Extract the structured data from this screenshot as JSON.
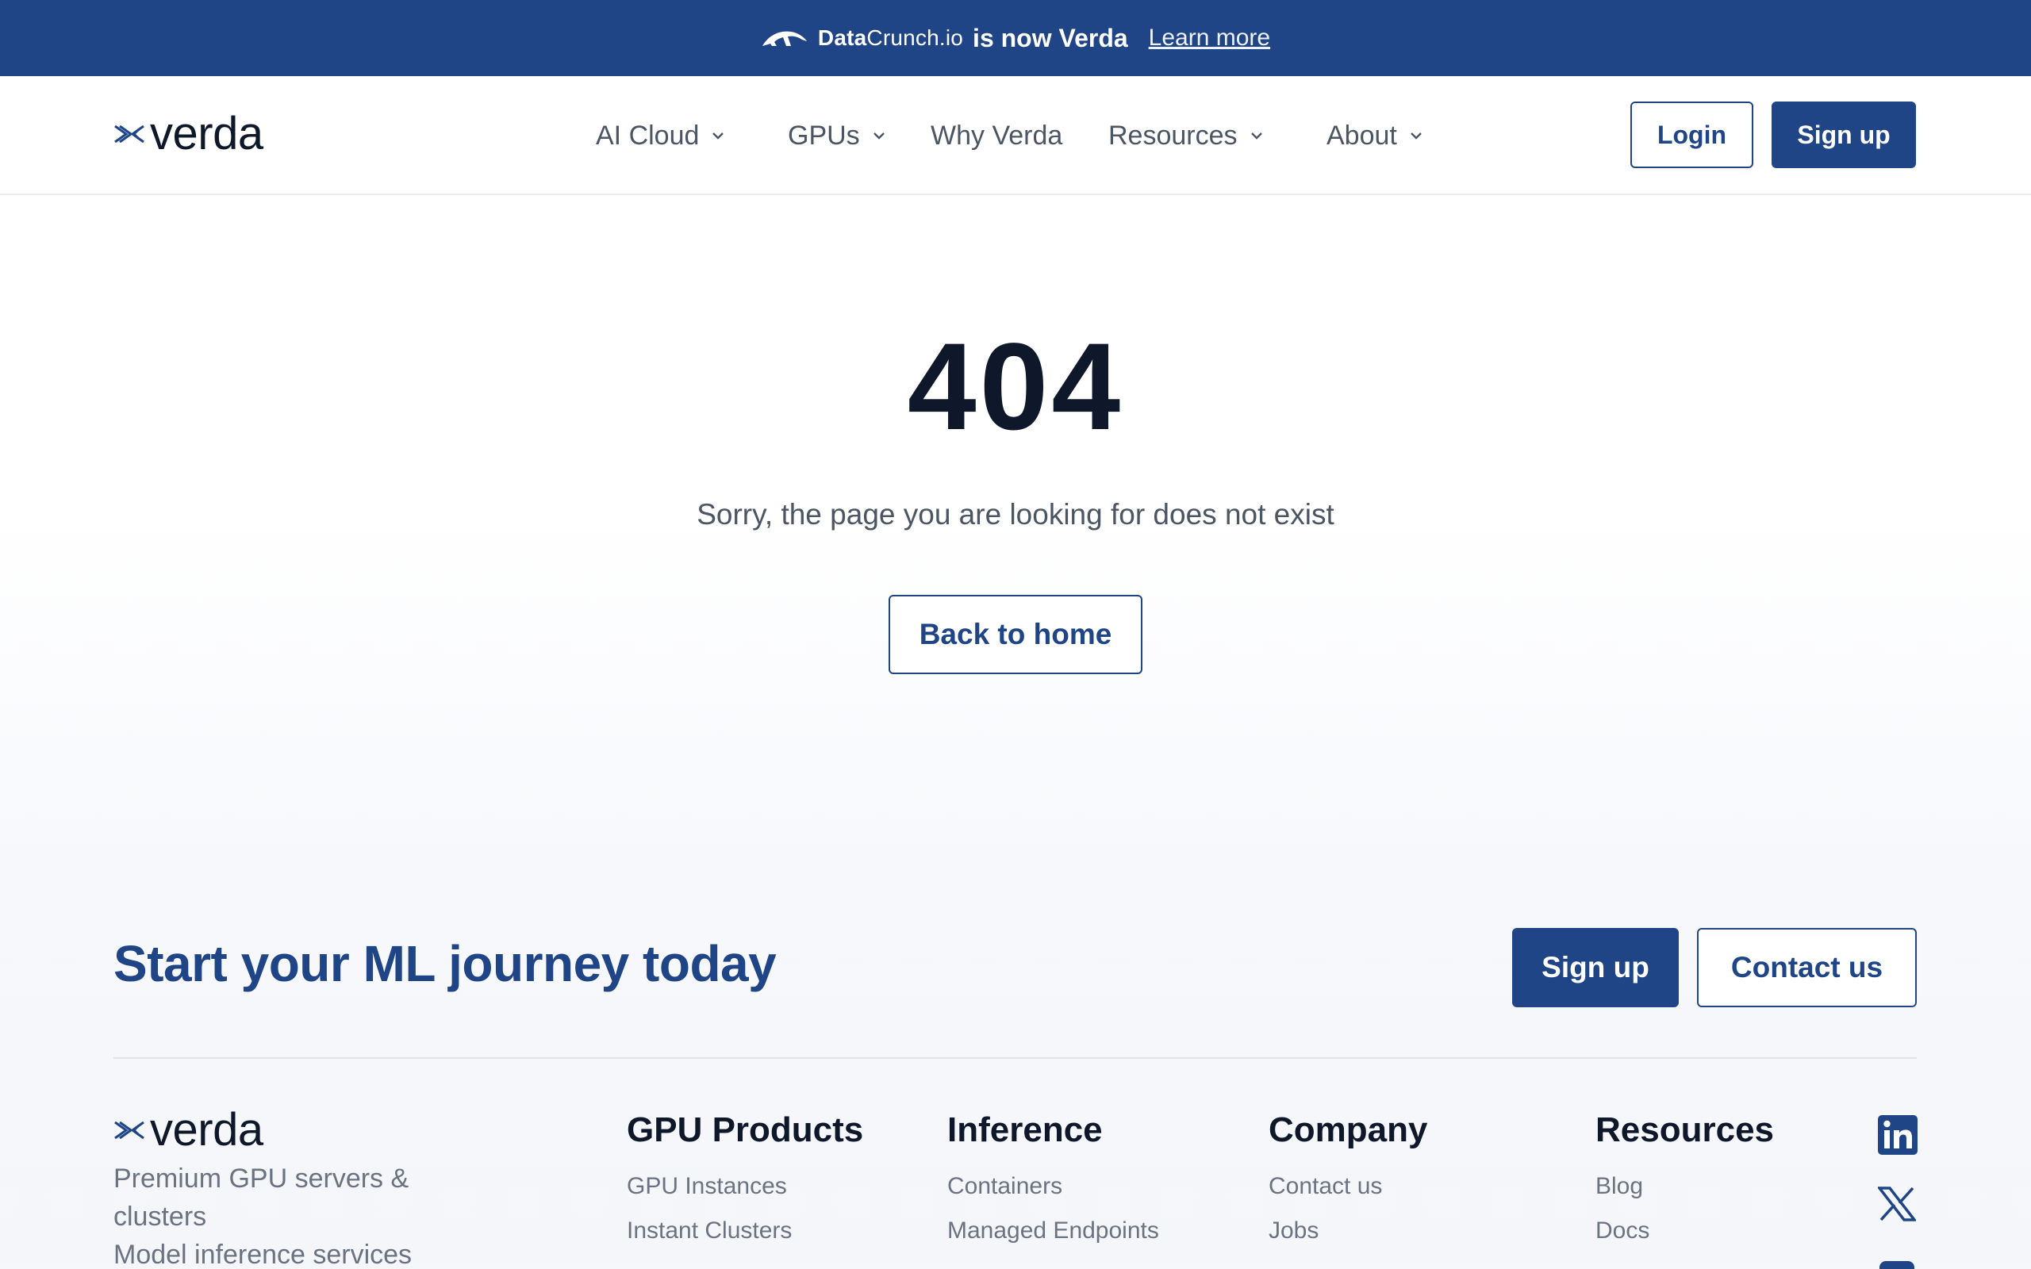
{
  "announcement": {
    "old_brand_bold": "Data",
    "old_brand_rest": "Crunch.io",
    "message": "is now Verda",
    "link": "Learn more"
  },
  "header": {
    "logo_text": "verda",
    "nav": [
      {
        "label": "AI Cloud",
        "has_dropdown": true
      },
      {
        "label": "GPUs",
        "has_dropdown": true
      },
      {
        "label": "Why Verda",
        "has_dropdown": false
      },
      {
        "label": "Resources",
        "has_dropdown": true
      },
      {
        "label": "About",
        "has_dropdown": true
      }
    ],
    "login": "Login",
    "signup": "Sign up"
  },
  "error": {
    "code": "404",
    "message": "Sorry, the page you are looking for does not exist",
    "back_button": "Back to home"
  },
  "cta": {
    "title": "Start your ML journey today",
    "signup": "Sign up",
    "contact": "Contact us"
  },
  "footer": {
    "logo_text": "verda",
    "tagline_line1": "Premium GPU servers &",
    "tagline_line2": "clusters",
    "tagline_line3": "Model inference services",
    "columns": [
      {
        "title": "GPU Products",
        "links": [
          "GPU Instances",
          "Instant Clusters"
        ]
      },
      {
        "title": "Inference",
        "links": [
          "Containers",
          "Managed Endpoints"
        ]
      },
      {
        "title": "Company",
        "links": [
          "Contact us",
          "Jobs"
        ]
      },
      {
        "title": "Resources",
        "links": [
          "Blog",
          "Docs"
        ]
      }
    ],
    "social": [
      "linkedin-icon",
      "x-icon",
      "calendar-icon"
    ]
  },
  "colors": {
    "brand_blue": "#1f4587",
    "text_dark": "#0f172a",
    "text_muted": "#6b7280"
  }
}
